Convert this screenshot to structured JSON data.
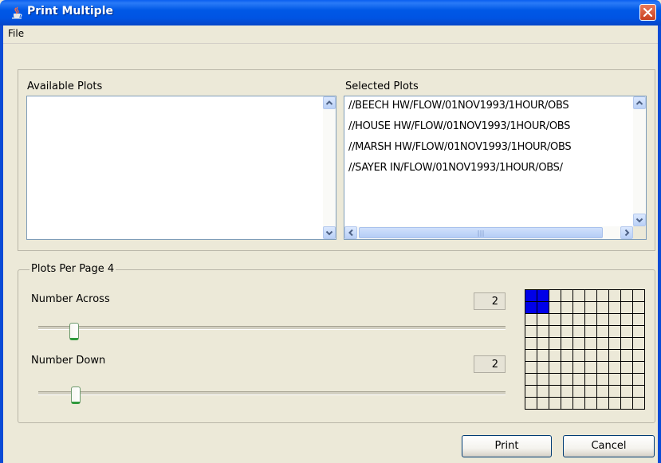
{
  "window": {
    "title": "Print Multiple",
    "icon": "java-cup-icon",
    "close_icon": "close-icon"
  },
  "menu": {
    "file": "File"
  },
  "available": {
    "label": "Available Plots",
    "items": []
  },
  "selected": {
    "label": "Selected Plots",
    "items": [
      "//BEECH HW/FLOW/01NOV1993/1HOUR/OBS",
      "//HOUSE HW/FLOW/01NOV1993/1HOUR/OBS",
      "//MARSH HW/FLOW/01NOV1993/1HOUR/OBS",
      "//SAYER IN/FLOW/01NOV1993/1HOUR/OBS/"
    ]
  },
  "per_page": {
    "label": "Plots Per Page 4",
    "across_label": "Number Across",
    "across_value": "2",
    "down_label": "Number Down",
    "down_value": "2",
    "grid_selection_color": "#0000e8"
  },
  "buttons": {
    "print": "Print",
    "cancel": "Cancel"
  },
  "colors": {
    "titlebar": "#0054e3",
    "window_bg": "#ece9d8"
  }
}
